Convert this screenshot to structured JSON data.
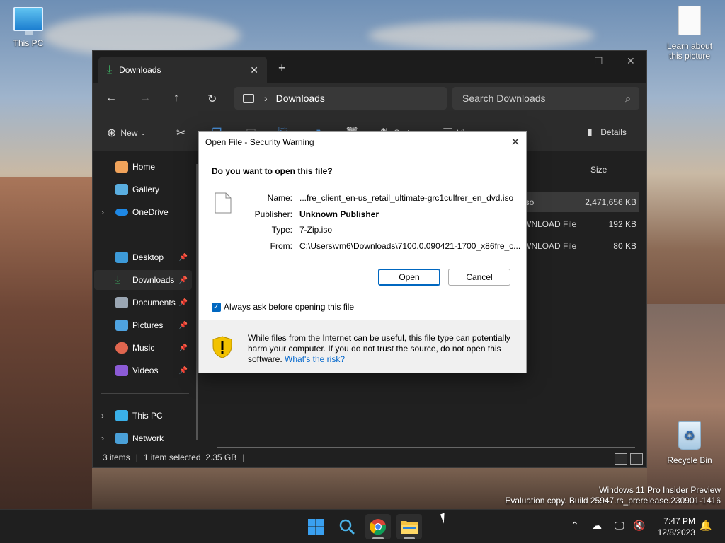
{
  "desktop": {
    "this_pc_label": "This PC",
    "learn_label_1": "Learn about",
    "learn_label_2": "this picture",
    "recycle_label": "Recycle Bin"
  },
  "explorer": {
    "tab_title": "Downloads",
    "address_location": "Downloads",
    "search_placeholder": "Search Downloads",
    "cmd_new": "New",
    "cmd_sort": "Sort",
    "cmd_view": "View",
    "cmd_details": "Details",
    "sidebar": [
      {
        "label": "Home",
        "icon": "home-icon"
      },
      {
        "label": "Gallery",
        "icon": "gallery-icon"
      },
      {
        "label": "OneDrive",
        "icon": "onedrive-icon"
      },
      {
        "label": "Desktop",
        "icon": "desktop-icon"
      },
      {
        "label": "Downloads",
        "icon": "download-icon"
      },
      {
        "label": "Documents",
        "icon": "documents-icon"
      },
      {
        "label": "Pictures",
        "icon": "pictures-icon"
      },
      {
        "label": "Music",
        "icon": "music-icon"
      },
      {
        "label": "Videos",
        "icon": "videos-icon"
      },
      {
        "label": "This PC",
        "icon": "pc-icon"
      },
      {
        "label": "Network",
        "icon": "network-icon"
      }
    ],
    "column_size": "Size",
    "files": [
      {
        "type": "iso",
        "size": "2,471,656 KB"
      },
      {
        "type": "WNLOAD File",
        "size": "192 KB"
      },
      {
        "type": "WNLOAD File",
        "size": "80 KB"
      }
    ],
    "status_items": "3 items",
    "status_selected": "1 item selected  2.35 GB"
  },
  "dialog": {
    "title": "Open File - Security Warning",
    "question": "Do you want to open this file?",
    "name_label": "Name:",
    "name_value": "...fre_client_en-us_retail_ultimate-grc1culfrer_en_dvd.iso",
    "publisher_label": "Publisher:",
    "publisher_value": "Unknown Publisher",
    "type_label": "Type:",
    "type_value": "7-Zip.iso",
    "from_label": "From:",
    "from_value": "C:\\Users\\vm6\\Downloads\\7100.0.090421-1700_x86fre_c...",
    "open_button": "Open",
    "cancel_button": "Cancel",
    "checkbox_label": "Always ask before opening this file",
    "warning_text": "While files from the Internet can be useful, this file type can potentially harm your computer. If you do not trust the source, do not open this software.",
    "warning_link": "What's the risk?"
  },
  "watermark": {
    "line1": "Windows 11 Pro Insider Preview",
    "line2": "Evaluation copy. Build 25947.rs_prerelease.230901-1416"
  },
  "taskbar": {
    "time": "7:47 PM",
    "date": "12/8/2023"
  },
  "colors": {
    "accent": "#0067c0",
    "download_green": "#3ba55d",
    "shield_yellow": "#f2c200"
  }
}
